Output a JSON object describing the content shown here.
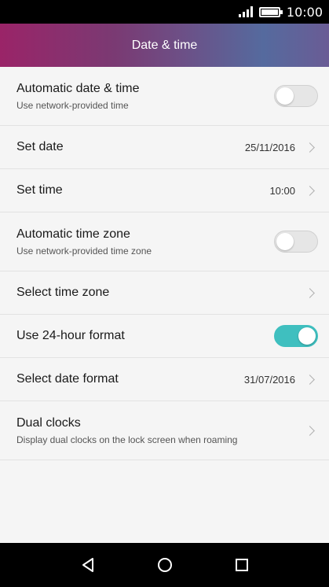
{
  "status_bar": {
    "time": "10:00"
  },
  "header": {
    "title": "Date & time"
  },
  "settings": [
    {
      "label": "Automatic date & time",
      "sublabel": "Use network-provided time",
      "toggle": false
    },
    {
      "label": "Set date",
      "value": "25/11/2016"
    },
    {
      "label": "Set time",
      "value": "10:00"
    },
    {
      "label": "Automatic time zone",
      "sublabel": "Use network-provided time zone",
      "toggle": false
    },
    {
      "label": "Select time zone"
    },
    {
      "label": "Use 24-hour format",
      "toggle": true
    },
    {
      "label": "Select date format",
      "value": "31/07/2016"
    },
    {
      "label": "Dual clocks",
      "sublabel": "Display dual clocks on the lock screen when roaming"
    }
  ],
  "icons": {
    "back": "back-triangle-icon",
    "home": "home-circle-icon",
    "recents": "recents-square-icon",
    "chevron": "chevron-right-icon",
    "signal": "signal-icon",
    "battery": "battery-icon"
  },
  "colors": {
    "toggle_on": "#3fbfbf",
    "header_gradient": [
      "#9a2468",
      "#556a9e"
    ]
  }
}
